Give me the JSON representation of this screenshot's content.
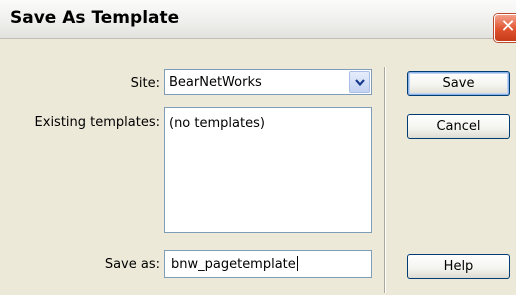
{
  "dialog": {
    "title": "Save As Template",
    "close_glyph": "✕"
  },
  "form": {
    "site_label": "Site:",
    "site_value": "BearNetWorks",
    "existing_label": "Existing templates:",
    "existing_items": [
      "(no templates)"
    ],
    "save_as_label": "Save as:",
    "save_as_value": "bnw_pagetemplate"
  },
  "buttons": {
    "save": "Save",
    "cancel": "Cancel",
    "help": "Help"
  },
  "icons": {
    "close": "close-icon",
    "dropdown": "chevron-down-icon"
  }
}
